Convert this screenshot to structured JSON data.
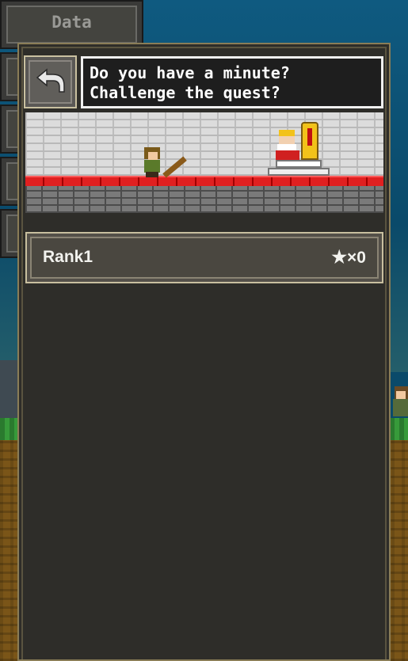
{
  "background_menu": {
    "top_button_label": "Data"
  },
  "dialog": {
    "speech_line_1": "Do you have a minute?",
    "speech_line_2": "Challenge the quest?"
  },
  "quest_list": [
    {
      "rank_label": "Rank1",
      "star_symbol": "★",
      "star_count": "×0"
    }
  ],
  "icons": {
    "back": "back-arrow-icon",
    "star": "star-icon"
  },
  "colors": {
    "panel_bg": "#2e2d29",
    "panel_border": "#8a7d57",
    "card_bg": "#545049",
    "speech_bg": "#1e1e1e",
    "carpet": "#e02020"
  }
}
